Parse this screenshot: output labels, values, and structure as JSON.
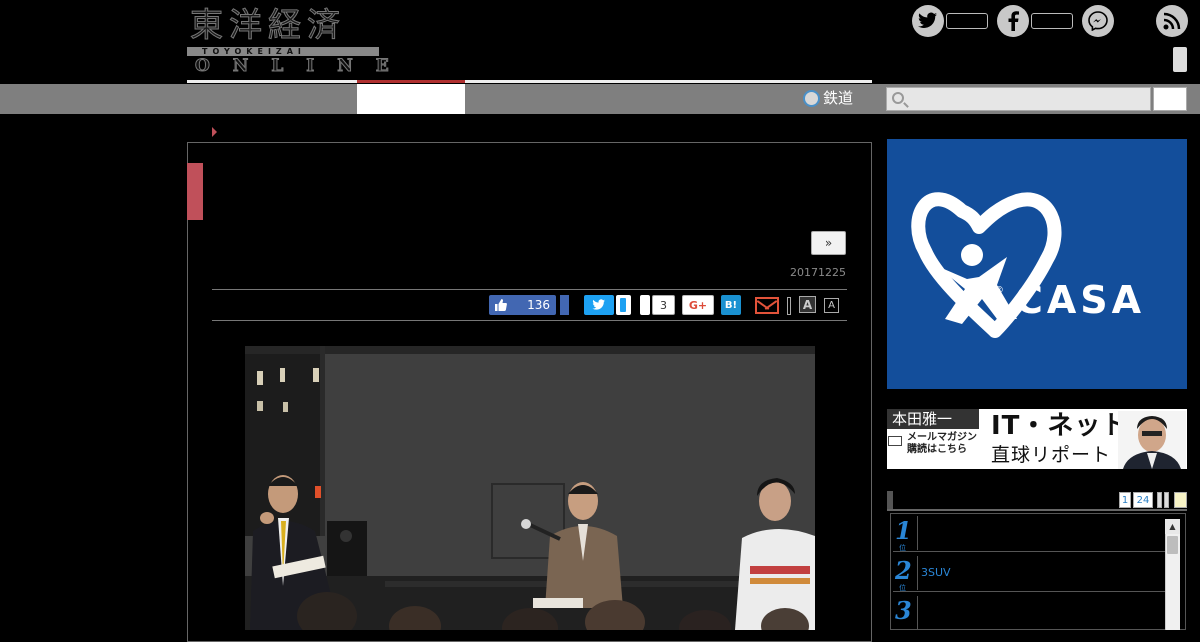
{
  "logo": {
    "kanji": "東洋経済",
    "roman": "TOYOKEIZAI",
    "online": "ONLINE"
  },
  "header": {
    "social": [
      "twitter-icon",
      "facebook-icon",
      "messenger-icon",
      "rss-icon"
    ]
  },
  "nav": {
    "rail_label": "鉄道",
    "search": {
      "value": "",
      "placeholder": ""
    }
  },
  "article": {
    "next_page_label": "»",
    "date": "20171225"
  },
  "share": {
    "fb_count": "136",
    "hatena_count": "3",
    "gplus_label": "G+",
    "hatebu_label": "B!",
    "font_large_label": "A",
    "font_small_label": "A"
  },
  "sidebar": {
    "ad_casa": {
      "text": "CASA",
      "reg": "®"
    },
    "banner_it": {
      "author": "本田雅一",
      "mail_line1": "メールマガジン",
      "mail_line2": "購読はこちら",
      "title_line1": "IT・ネット",
      "title_line2": "直球リポート"
    },
    "ranking": {
      "tabs": [
        "1",
        "24"
      ],
      "items": [
        {
          "rank": "1",
          "sub": "位",
          "title": ""
        },
        {
          "rank": "2",
          "sub": "位",
          "title": "3SUV"
        },
        {
          "rank": "3",
          "sub": "",
          "title": ""
        }
      ],
      "scroll_up": "▲"
    }
  },
  "colors": {
    "accent": "#c0505a",
    "nav_bar": "#7f7f7f",
    "casa_blue": "#134e9b",
    "rank_blue": "#2a86d6",
    "facebook": "#4267b2",
    "twitter": "#1da1f2"
  }
}
